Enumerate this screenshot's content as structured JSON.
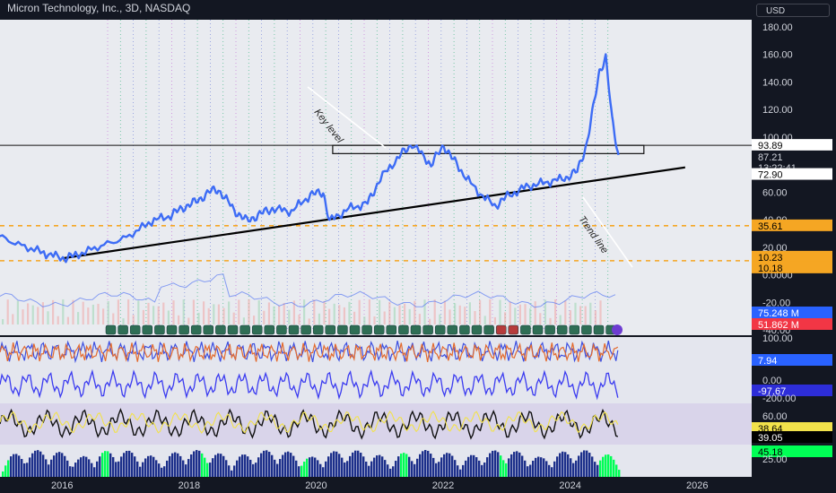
{
  "header": {
    "title": "Micron Technology, Inc., 3D, NASDAQ",
    "currency": "USD"
  },
  "colors": {
    "price": "#3d6cf5",
    "trend": "#000000",
    "level": "#f5a623",
    "panel_bg": "#131722",
    "up": "#00ff55",
    "down": "#ff3a3a"
  },
  "chart_data": {
    "type": "line",
    "price": {
      "name": "",
      "ylim": [
        -40,
        180
      ],
      "y_ticks": [
        "180.00",
        "160.00",
        "140.00",
        "120.00",
        "100.00",
        "80.00",
        "60.00",
        "40.00",
        "20.00",
        "0.0000",
        "-20.00",
        "-40.00"
      ],
      "x": [
        2014.9,
        2015.3,
        2015.7,
        2016.0,
        2016.2,
        2016.6,
        2017.0,
        2017.4,
        2017.7,
        2017.9,
        2018.1,
        2018.3,
        2018.45,
        2018.7,
        2018.9,
        2019.1,
        2019.3,
        2019.6,
        2019.9,
        2020.1,
        2020.2,
        2020.5,
        2020.8,
        2021.0,
        2021.3,
        2021.5,
        2021.8,
        2022.0,
        2022.2,
        2022.5,
        2022.8,
        2023.0,
        2023.3,
        2023.6,
        2023.9,
        2024.1,
        2024.25,
        2024.35,
        2024.45,
        2024.55,
        2024.65,
        2024.75
      ],
      "values": [
        30,
        22,
        16,
        12,
        14,
        21,
        27,
        39,
        43,
        49,
        53,
        60,
        62,
        47,
        39,
        44,
        48,
        46,
        58,
        60,
        39,
        48,
        52,
        70,
        86,
        95,
        80,
        94,
        80,
        62,
        50,
        57,
        64,
        67,
        70,
        75,
        95,
        120,
        148,
        158,
        112,
        87
      ],
      "price_labels": {
        "current": "87.21",
        "countdown": "13:22:41",
        "level_top": "93.89",
        "level_mid": "72.90",
        "level_low1": "35.61",
        "level_low2": "10.23",
        "level_low3": "10.18"
      },
      "hline": 94,
      "box": {
        "x0": 2020.25,
        "x1": 2025.15,
        "y0": 88,
        "y1": 94
      },
      "trendline": {
        "x": [
          2016.0,
          2025.8
        ],
        "y": [
          12,
          78
        ]
      },
      "dashed_levels": [
        35.6,
        10.2
      ],
      "annotations": [
        "Key level",
        "Trend line"
      ]
    },
    "volume": {
      "labels": [
        "75.248 M",
        "51.862 M"
      ]
    },
    "osc1": {
      "ticks": [
        "100.00"
      ],
      "labels": [
        "7.94"
      ]
    },
    "osc2": {
      "ticks": [
        "0.00",
        "-200.00"
      ],
      "labels": [
        "-97.67"
      ]
    },
    "osc3": {
      "ticks": [
        "60.00",
        "40.00"
      ],
      "labels": [
        "38.64",
        "39.05"
      ]
    },
    "osc4": {
      "ticks": [
        "25.00"
      ],
      "labels": [
        "45.18"
      ]
    },
    "x_ticks": [
      "2016",
      "2018",
      "2020",
      "2022",
      "2024",
      "2026"
    ],
    "grid": false
  }
}
